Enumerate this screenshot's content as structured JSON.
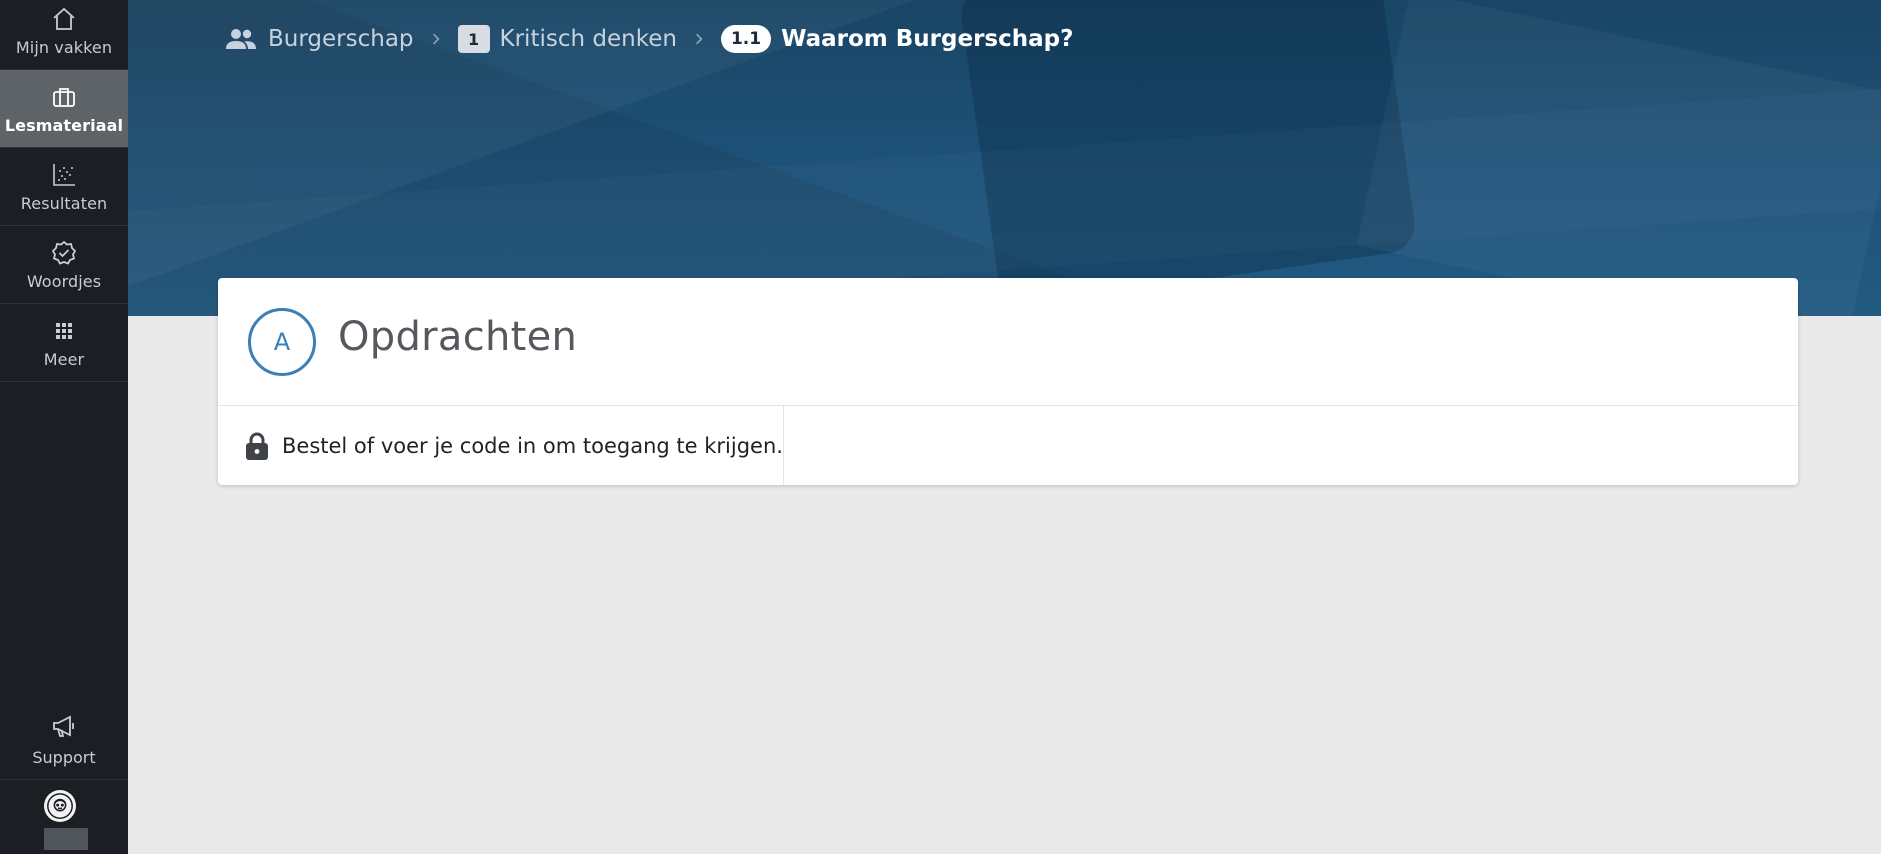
{
  "sidebar": {
    "items": [
      {
        "label": "Mijn vakken",
        "icon": "home-icon"
      },
      {
        "label": "Lesmateriaal",
        "icon": "briefcase-icon",
        "active": true
      },
      {
        "label": "Resultaten",
        "icon": "scatter-chart-icon"
      },
      {
        "label": "Woordjes",
        "icon": "badge-check-icon"
      },
      {
        "label": "Meer",
        "icon": "grid-icon"
      }
    ],
    "support": {
      "label": "Support",
      "icon": "megaphone-icon"
    },
    "avatar": {
      "icon": "user-avatar-icon"
    }
  },
  "breadcrumb": {
    "course": {
      "label": "Burgerschap",
      "icon": "people-icon"
    },
    "chapter": {
      "number": "1",
      "label": "Kritisch denken"
    },
    "section": {
      "number": "1.1",
      "label": "Waarom Burgerschap?"
    },
    "separator_icon": "chevron-right-icon"
  },
  "card": {
    "letter": "A",
    "title": "Opdrachten",
    "access_message": "Bestel of voer je code in om toegang te krijgen.",
    "lock_icon": "lock-icon"
  },
  "colors": {
    "sidebar_bg": "#1b1f24",
    "sidebar_active": "#5e6368",
    "banner": "#1d5076",
    "accent": "#3a7fb8",
    "page_bg": "#e9e9e9"
  }
}
